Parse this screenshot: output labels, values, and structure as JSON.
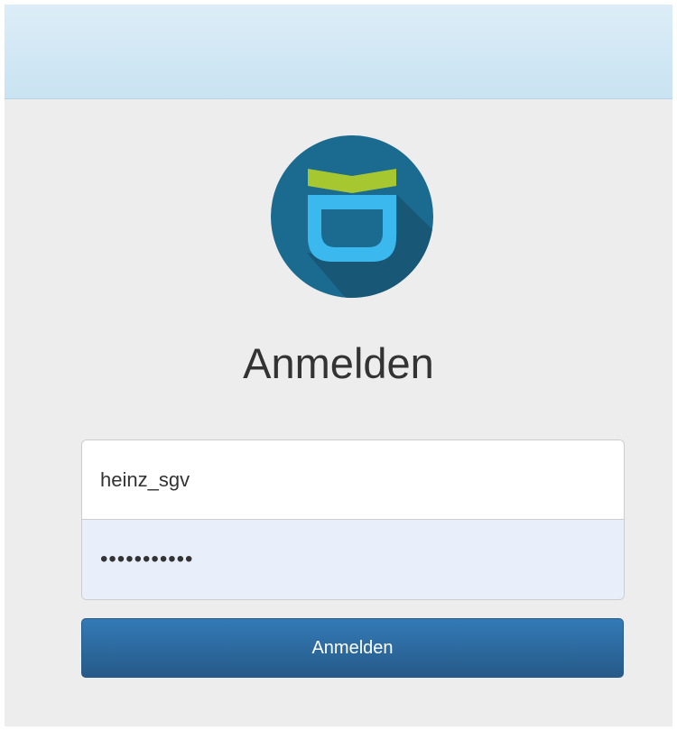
{
  "header": {
    "title": "Anmelden"
  },
  "logo": {
    "icon": "app-logo-icon",
    "colors": {
      "circle": "#1b6a90",
      "shadow": "#185775",
      "top_band": "#a7c731",
      "cup": "#3bb8ee"
    }
  },
  "form": {
    "username_value": "heinz_sgv",
    "password_value": "•••••••••••",
    "submit_label": "Anmelden"
  },
  "colors": {
    "topbar": "#cfe6f3",
    "page_background": "#ededed",
    "button": "#2f6fa8",
    "password_field": "#e8effb"
  }
}
